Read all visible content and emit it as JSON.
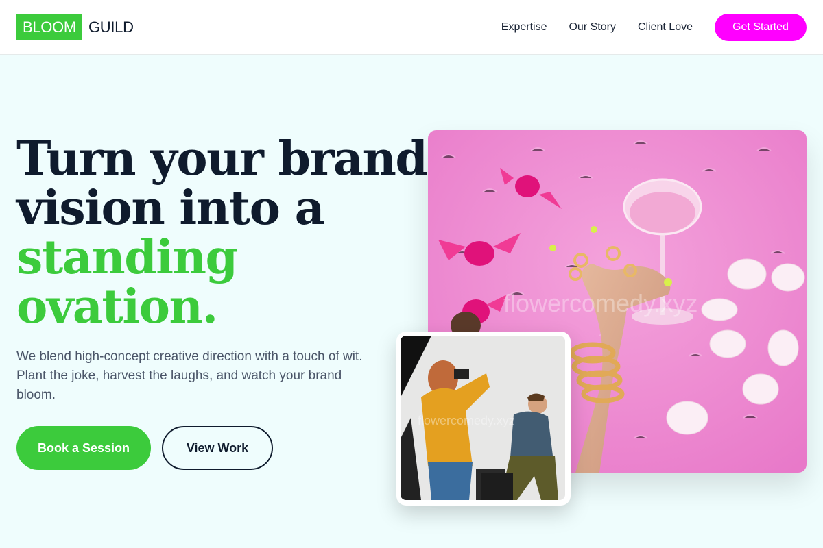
{
  "brand": {
    "logo_highlight": "BLOOM",
    "logo_word": "GUILD",
    "accent_green": "#3ccb3c",
    "accent_magenta": "#ff00ff",
    "text_dark": "#0f1b2d"
  },
  "nav": {
    "links": [
      "Expertise",
      "Our Story",
      "Client Love"
    ],
    "cta_label": "Get Started"
  },
  "hero": {
    "headline_line1": "Turn your brand",
    "headline_line2": "vision into a",
    "headline_accent_line1": "standing",
    "headline_accent_line2": "ovation.",
    "subtext": "We blend high-concept creative direction with a touch of wit. Plant the joke, harvest the laughs, and watch your brand bloom.",
    "primary_button": "Book a Session",
    "secondary_button": "View Work"
  },
  "images": {
    "main_watermark": "flowercomedy.xyz",
    "small_watermark": "flowercomedy.xyz",
    "main_icon": "pink-candy-cocktail-photo",
    "small_icon": "photographer-shoot-photo"
  }
}
